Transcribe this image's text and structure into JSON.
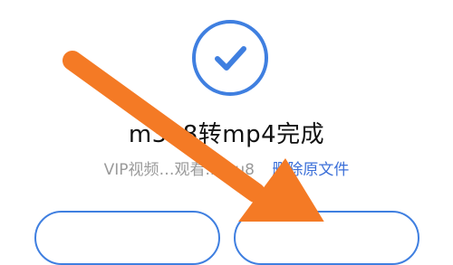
{
  "dialog": {
    "title": "m3u8转mp4完成",
    "file_name": "VIP视频…观看.m3u8",
    "delete_label": "删除原文件",
    "buttons": [
      "",
      ""
    ]
  },
  "colors": {
    "accent": "#3f7fe0",
    "link": "#3b6fd8",
    "arrow": "#f47a25",
    "title": "#111111",
    "muted": "#9a9a9a"
  },
  "icons": {
    "success": "checkmark-circle-icon",
    "annotation": "orange-arrow-annotation"
  }
}
